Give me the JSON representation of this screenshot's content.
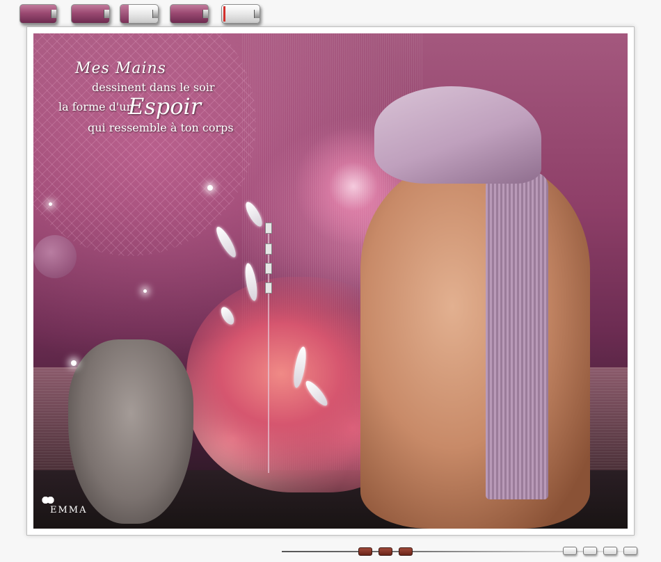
{
  "poem": {
    "line1": "Mes Mains",
    "line2": "dessinent dans le soir",
    "line3a": "la forme d'un",
    "line3b": "Espoir",
    "line4": "qui ressemble à ton corps"
  },
  "signature": "EMMA",
  "top_bar": {
    "swatches": [
      "full",
      "full",
      "half",
      "full",
      "mostly-empty"
    ]
  },
  "colors": {
    "accent": "#9b4a72",
    "frame": "#ffffff",
    "background": "#f7f7f7"
  }
}
